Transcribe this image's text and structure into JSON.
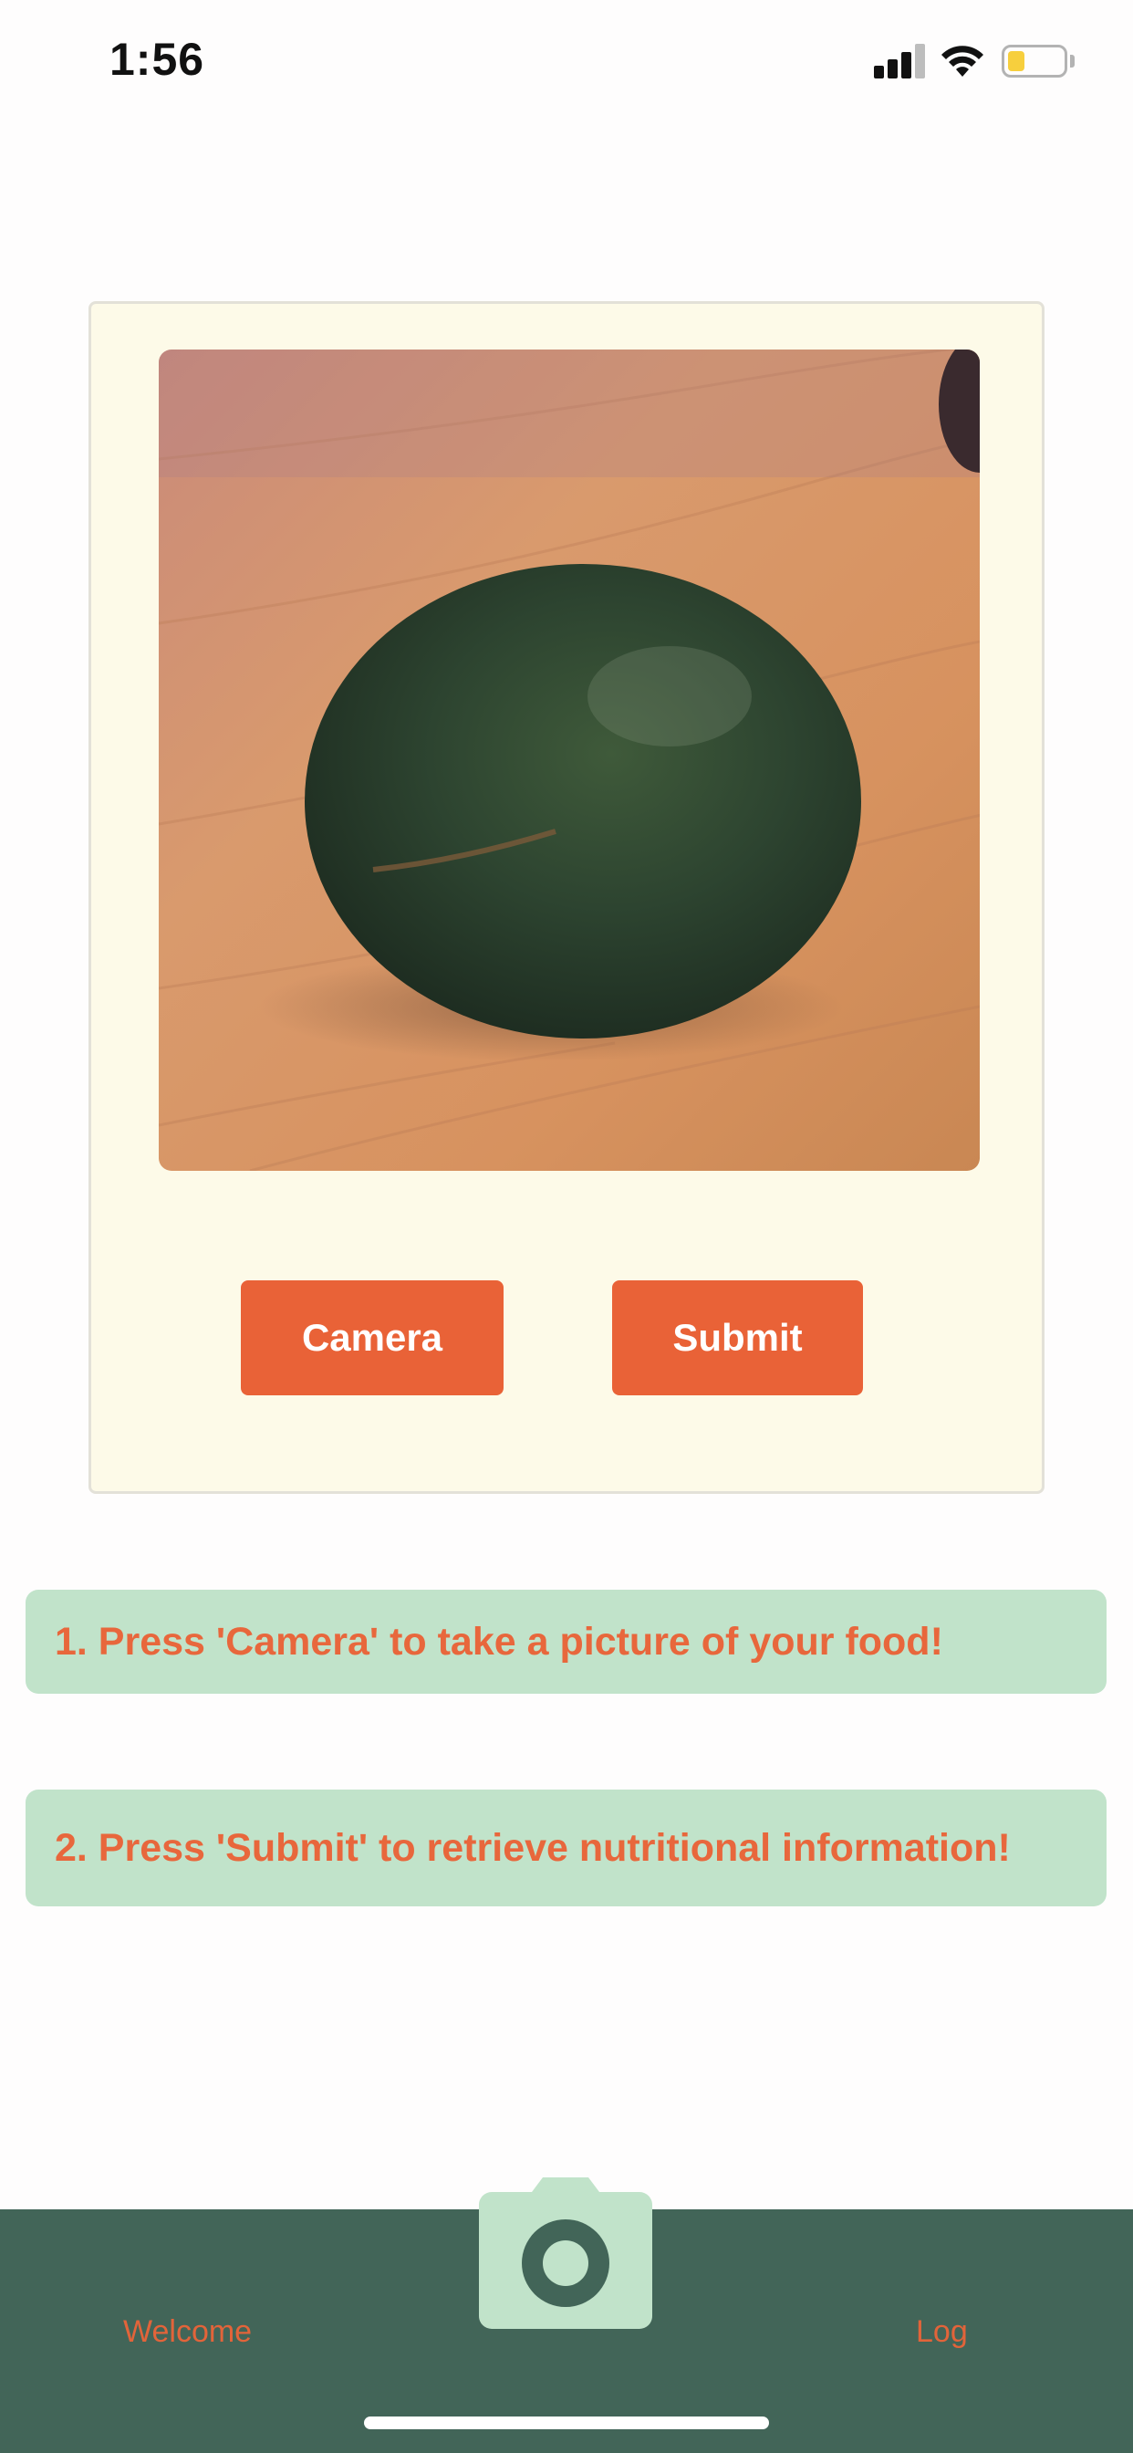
{
  "status_bar": {
    "time": "1:56",
    "icons": [
      "signal-icon",
      "wifi-icon",
      "battery-icon"
    ],
    "battery_color": "#f7cf3d"
  },
  "card": {
    "photo_alt": "avocado-photo",
    "camera_button_label": "Camera",
    "submit_button_label": "Submit"
  },
  "instructions": [
    {
      "text": "1. Press 'Camera' to take a picture of your food!"
    },
    {
      "text": "2. Press 'Submit' to retrieve nutritional information!"
    }
  ],
  "tab_bar": {
    "welcome_label": "Welcome",
    "log_label": "Log",
    "center_icon": "camera-icon"
  },
  "colors": {
    "accent": "#e96237",
    "card_bg": "#fdfae8",
    "instruction_bg": "#c1e3ca",
    "tab_bar_bg": "#426558"
  }
}
